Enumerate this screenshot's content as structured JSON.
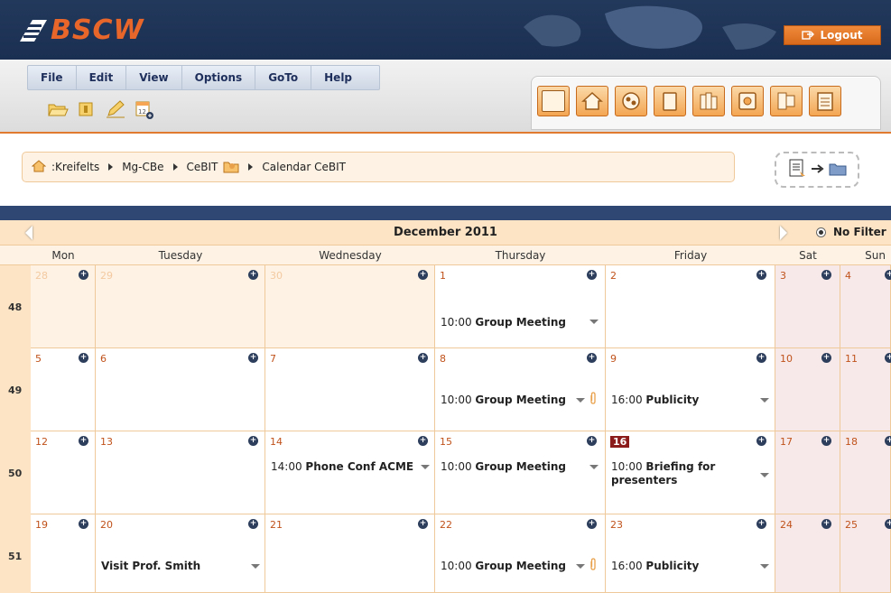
{
  "app": {
    "logo_text": "BSCW",
    "logout_label": "Logout"
  },
  "menu": [
    "File",
    "Edit",
    "View",
    "Options",
    "GoTo",
    "Help"
  ],
  "breadcrumb": [
    ":Kreifelts",
    "Mg-CBe",
    "CeBIT",
    "Calendar CeBIT"
  ],
  "calendar": {
    "month_title": "December 2011",
    "filter_label": "No Filter",
    "day_headers": [
      "Mon",
      "Tuesday",
      "Wednesday",
      "Thursday",
      "Friday",
      "Sat",
      "Sun"
    ],
    "weeks": [
      {
        "number": "48",
        "days": [
          "28",
          "29",
          "30",
          "1",
          "2",
          "3",
          "4"
        ]
      },
      {
        "number": "49",
        "days": [
          "5",
          "6",
          "7",
          "8",
          "9",
          "10",
          "11"
        ]
      },
      {
        "number": "50",
        "days": [
          "12",
          "13",
          "14",
          "15",
          "16",
          "17",
          "18"
        ]
      },
      {
        "number": "51",
        "days": [
          "19",
          "20",
          "21",
          "22",
          "23",
          "24",
          "25"
        ]
      }
    ],
    "events": {
      "w48_thu": {
        "time": "10:00",
        "title": "Group Meeting"
      },
      "w49_thu": {
        "time": "10:00",
        "title": "Group Meeting"
      },
      "w49_fri": {
        "time": "16:00",
        "title": "Publicity"
      },
      "w50_wed": {
        "time": "14:00",
        "title": "Phone Conf ACME"
      },
      "w50_thu": {
        "time": "10:00",
        "title": "Group Meeting"
      },
      "w50_fri": {
        "time": "10:00",
        "title": "Briefing for presenters"
      },
      "w51_tue": {
        "time": "",
        "title": "Visit Prof. Smith"
      },
      "w51_thu": {
        "time": "10:00",
        "title": "Group Meeting"
      },
      "w51_fri": {
        "time": "16:00",
        "title": "Publicity"
      }
    }
  },
  "colors": {
    "header_bg": "#1f3458",
    "accent_orange": "#e8662a",
    "cal_bg": "#fdf2e4",
    "today_bg": "#8b1a1a"
  }
}
